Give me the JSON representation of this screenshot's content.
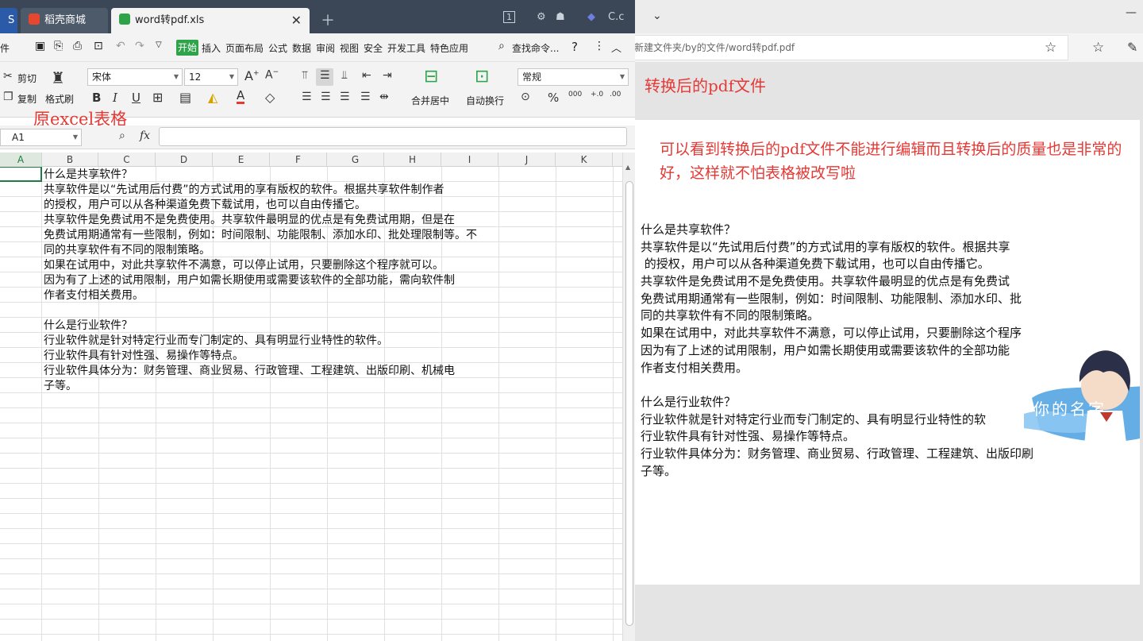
{
  "wps": {
    "tabs": [
      {
        "label": "S"
      },
      {
        "label": "稻壳商城"
      },
      {
        "label": "word转pdf.xls"
      }
    ],
    "titlebar_icons": {
      "badge": "1",
      "user": "C.c"
    },
    "menu": {
      "file_partial": "件",
      "start": "开始",
      "items": [
        "插入",
        "页面布局",
        "公式",
        "数据",
        "审阅",
        "视图",
        "安全",
        "开发工具",
        "特色应用"
      ],
      "search": "查找命令...",
      "help": "?"
    },
    "ribbon": {
      "cut": "剪切",
      "copy": "复制",
      "format_painter": "格式刷",
      "font_name": "宋体",
      "font_size": "12",
      "merge_center": "合并居中",
      "wrap_text": "自动换行",
      "number_format": "常规",
      "percent": "%",
      "thousands": "000",
      "inc_dec": "+.0",
      "dec_dec": ".00"
    },
    "formula_bar": {
      "name_box": "A1",
      "fx": "fx"
    },
    "columns": [
      "A",
      "B",
      "C",
      "D",
      "E",
      "F",
      "G",
      "H",
      "I",
      "J",
      "K"
    ],
    "annotation": "原excel表格",
    "cells": [
      "什么是共享软件？",
      "共享软件是以“先试用后付费”的方式试用的享有版权的软件。根据共享软件制作者",
      "的授权，用户可以从各种渠道免费下载试用，也可以自由传播它。",
      "共享软件是免费试用不是免费使用。共享软件最明显的优点是有免费试用期，但是在",
      "免费试用期通常有一些限制，例如：时间限制、功能限制、添加水印、批处理限制等。不",
      "同的共享软件有不同的限制策略。",
      "如果在试用中，对此共享软件不满意，可以停止试用，只要删除这个程序就可以。",
      "因为有了上述的试用限制，用户如需长期使用或需要该软件的全部功能，需向软件制",
      "作者支付相关费用。",
      "",
      "什么是行业软件？",
      "行业软件就是针对特定行业而专门制定的、具有明显行业特性的软件。",
      "行业软件具有针对性强、易操作等特点。",
      "行业软件具体分为：财务管理、商业贸易、行政管理、工程建筑、出版印刷、机械电",
      "子等。"
    ]
  },
  "browser": {
    "address": "新建文件夹/by的文件/word转pdf.pdf",
    "annotation": "转换后的pdf文件",
    "note": "可以看到转换后的pdf文件不能进行编辑而且转换后的质量也是非常的好，这样就不怕表格被改写啦",
    "pdf_lines": [
      "什么是共享软件？",
      "共享软件是以“先试用后付费”的方式试用的享有版权的软件。根据共享",
      " 的授权，用户可以从各种渠道免费下载试用，也可以自由传播它。",
      "共享软件是免费试用不是免费使用。共享软件最明显的优点是有免费试",
      "免费试用期通常有一些限制，例如：时间限制、功能限制、添加水印、批",
      "同的共享软件有不同的限制策略。",
      "如果在试用中，对此共享软件不满意，可以停止试用，只要删除这个程序",
      "因为有了上述的试用限制，用户如需长期使用或需要该软件的全部功能",
      "作者支付相关费用。",
      "",
      "什么是行业软件？",
      "行业软件就是针对特定行业而专门制定的、具有明显行业特性的软",
      "行业软件具有针对性强、易操作等特点。",
      "行业软件具体分为：财务管理、商业贸易、行政管理、工程建筑、出版印刷",
      "子等。"
    ],
    "sticker_text": "你的名字"
  },
  "colors": {
    "accent_green": "#2ea34a",
    "annotation_red": "#e53935",
    "tabbar": "#3b4756"
  }
}
